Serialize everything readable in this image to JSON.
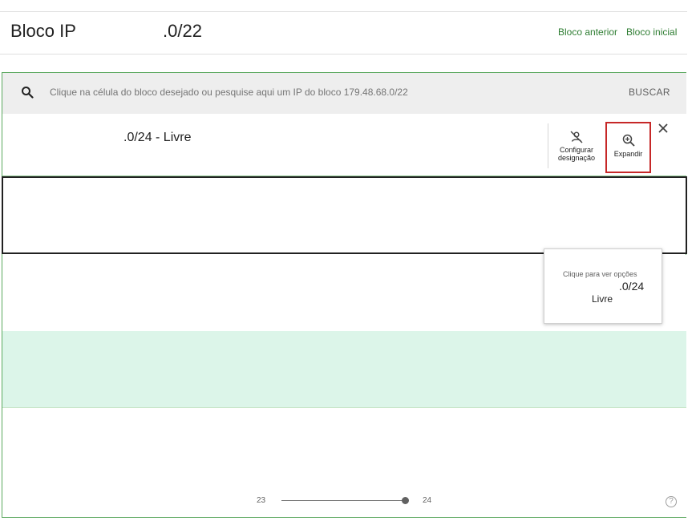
{
  "header": {
    "title": "Bloco IP",
    "title_suffix": ".0/22",
    "prev_block_link": "Bloco anterior",
    "first_block_link": "Bloco inicial"
  },
  "search": {
    "placeholder": "Clique na célula do bloco desejado ou pesquise aqui um IP do bloco 179.48.68.0/22",
    "button_label": "BUSCAR",
    "icon": "search-icon"
  },
  "selected_block": {
    "label": ".0/24 - Livre",
    "config_label_line1": "Configurar",
    "config_label_line2": "designação",
    "config_icon": "person-off-icon",
    "expand_label": "Expandir",
    "expand_icon": "zoom-in-icon",
    "close_icon": "close-icon"
  },
  "tooltip": {
    "hint": "Clique para ver opções",
    "block": ".0/24",
    "status": "Livre"
  },
  "slider": {
    "min_label": "23",
    "max_label": "24",
    "value": 24
  },
  "footer": {
    "help_label": "?"
  },
  "colors": {
    "accent_green": "#2e7d32",
    "row_green": "#dcf5e9",
    "highlight_red": "#c62828"
  }
}
